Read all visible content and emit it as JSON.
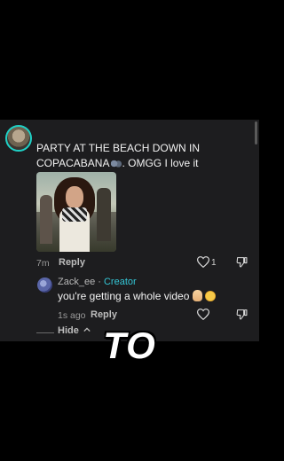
{
  "comment": {
    "text": "PARTY AT THE BEACH DOWN IN COPACABANA",
    "text_tail": ". OMGG I love it",
    "time": "7m",
    "reply_label": "Reply",
    "like_count": "1"
  },
  "reply": {
    "username": "Zack_ee",
    "separator": " · ",
    "badge": "Creator",
    "text": "you're getting a whole video",
    "time": "1s ago",
    "reply_label": "Reply"
  },
  "hide_label": "Hide",
  "caption": "TO",
  "colors": {
    "accent": "#34c6d6",
    "avatar_ring": "#1fd1c6",
    "panel_bg": "#1d1d1f"
  }
}
